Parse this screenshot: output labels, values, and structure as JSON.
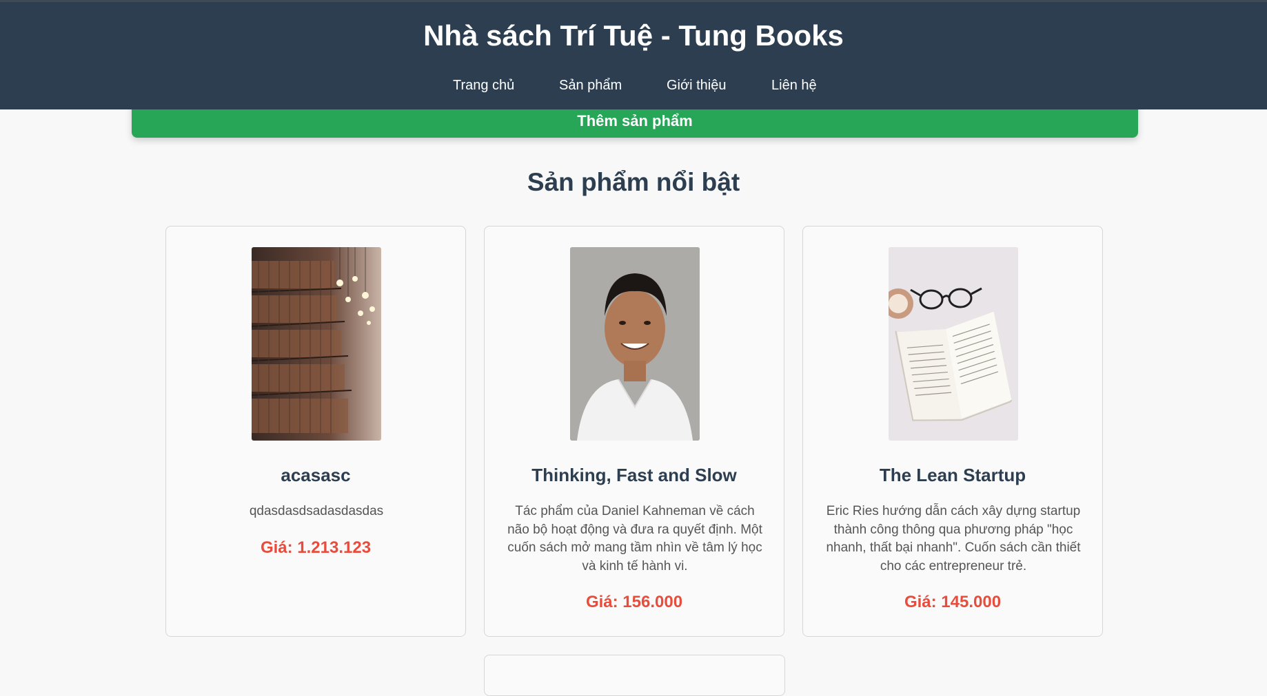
{
  "header": {
    "site_title": "Nhà sách Trí Tuệ - Tung Books",
    "nav": [
      "Trang chủ",
      "Sản phẩm",
      "Giới thiệu",
      "Liên hệ"
    ]
  },
  "add_button": {
    "label": "Thêm sản phẩm"
  },
  "featured": {
    "title": "Sản phẩm nổi bật",
    "products": [
      {
        "title": "acasasc",
        "description": "qdasdasdsadasdasdas",
        "price": "Giá: 1.213.123",
        "image": "library-bookshelf-photo"
      },
      {
        "title": "Thinking, Fast and Slow",
        "description": "Tác phẩm của Daniel Kahneman về cách não bộ hoạt động và đưa ra quyết định. Một cuốn sách mở mang tầm nhìn về tâm lý học và kinh tế hành vi.",
        "price": "Giá: 156.000",
        "image": "portrait-photo"
      },
      {
        "title": "The Lean Startup",
        "description": "Eric Ries hướng dẫn cách xây dựng startup thành công thông qua phương pháp \"học nhanh, thất bại nhanh\". Cuốn sách cần thiết cho các entrepreneur trẻ.",
        "price": "Giá: 145.000",
        "image": "open-book-photo"
      }
    ]
  },
  "colors": {
    "header_bg": "#2c3e50",
    "button_green": "#27a658",
    "price_red": "#e74c3c"
  }
}
